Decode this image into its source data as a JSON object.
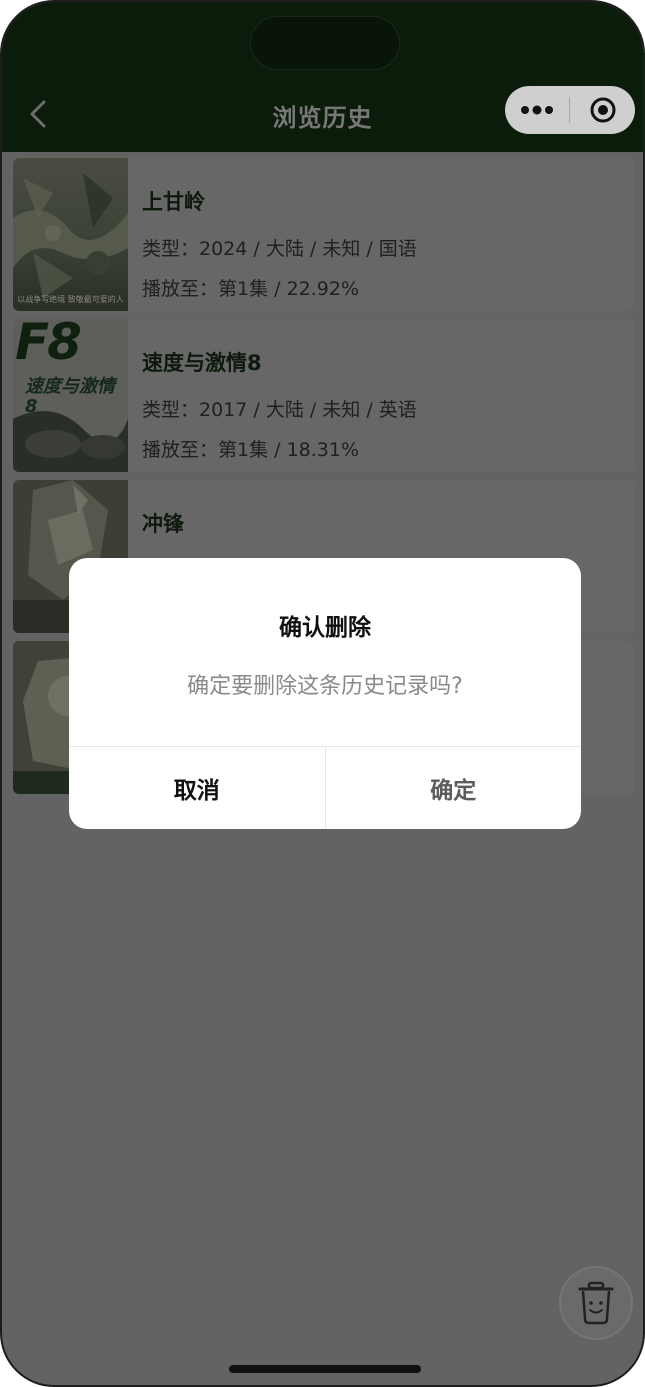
{
  "header": {
    "title": "浏览历史"
  },
  "history": [
    {
      "title": "上甘岭",
      "type_line": "类型：2024 / 大陆 / 未知 / 国语",
      "progress_line": "播放至：第1集 / 22.92%",
      "poster_caption": "以战争写绝境 致敬最可爱的人"
    },
    {
      "title": "速度与激情8",
      "type_line": "类型：2017 / 大陆 / 未知 / 英语",
      "progress_line": "播放至：第1集 / 18.31%",
      "poster_big": "F8",
      "poster_sub": "速度与激情8"
    },
    {
      "title": "冲锋",
      "type_line": "",
      "progress_line": ""
    },
    {
      "title": "",
      "type_line": "",
      "progress_line": ""
    }
  ],
  "dialog": {
    "title": "确认删除",
    "message": "确定要删除这条历史记录吗?",
    "cancel_label": "取消",
    "confirm_label": "确定"
  },
  "colors": {
    "brand_green": "#143d14",
    "overlay": "#636363"
  }
}
